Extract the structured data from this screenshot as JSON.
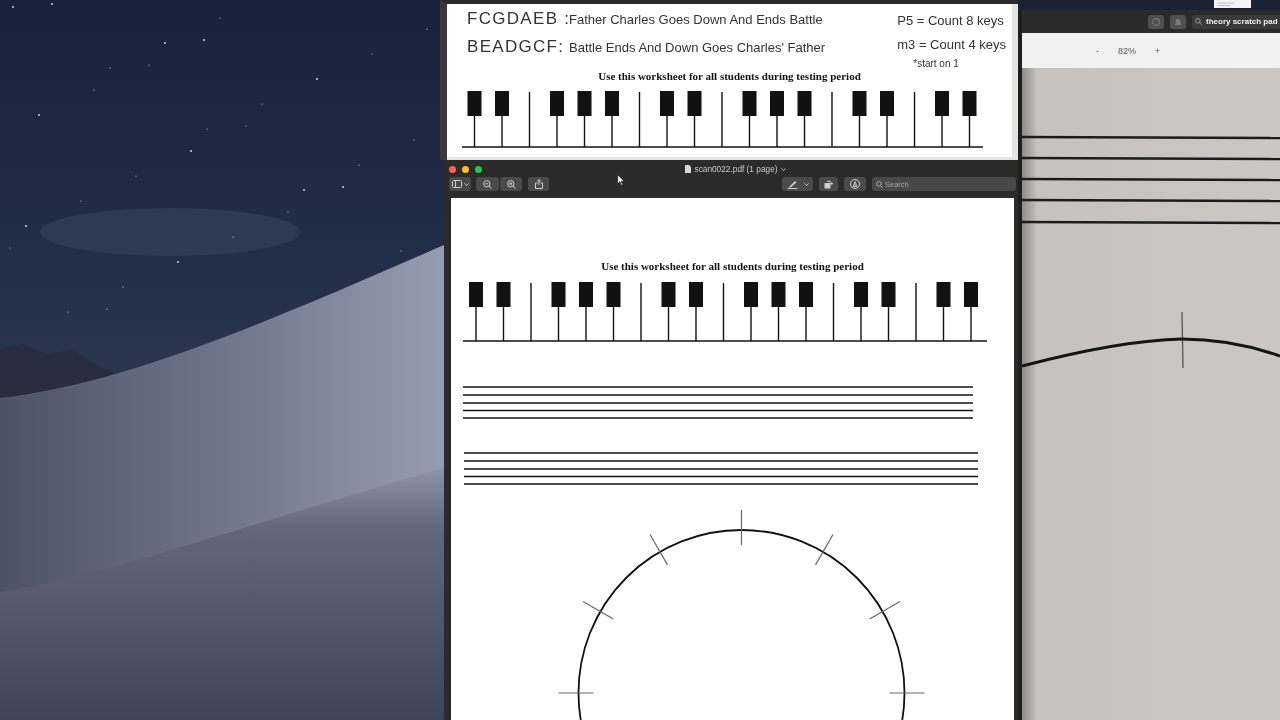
{
  "back_window": {
    "mnemonics": [
      {
        "sequence": "FCGDAEB :",
        "phrase": "Father Charles Goes Down And Ends Battle"
      },
      {
        "sequence": "BEADGCF:",
        "phrase": "Battle Ends And Down Goes Charles' Father"
      }
    ],
    "notes": [
      {
        "kind": "rule",
        "text": "P5 = Count 8 keys"
      },
      {
        "kind": "rule",
        "text": "m3 = Count 4 keys"
      },
      {
        "kind": "footnote",
        "text": "*start on 1"
      }
    ],
    "heading": "Use this worksheet for all students during testing period"
  },
  "preview_window": {
    "title": "scan0022.pdf (1 page)",
    "search": {
      "placeholder": "Search"
    },
    "page": {
      "heading": "Use this worksheet for all students during testing period"
    }
  },
  "scratch_window": {
    "search": {
      "value": "theory scratch pad"
    },
    "zoom": {
      "minus": "-",
      "value": "82%",
      "plus": "+"
    }
  }
}
